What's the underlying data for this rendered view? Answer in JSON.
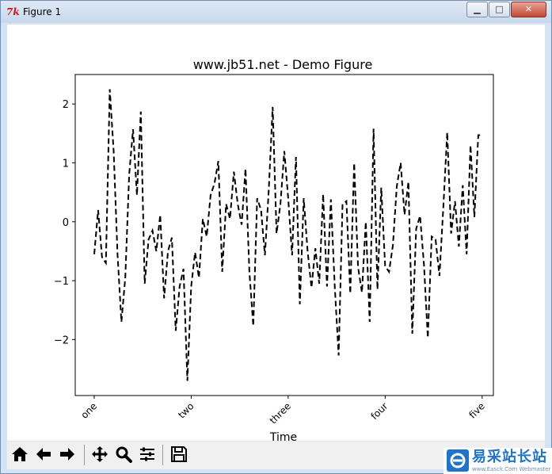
{
  "window": {
    "title": "Figure 1",
    "icon": "tk-feather-icon",
    "controls": {
      "minimize": "minimize-icon",
      "maximize": "maximize-icon",
      "close": "close-icon"
    }
  },
  "chart_data": {
    "type": "line",
    "title": "www.jb51.net - Demo Figure",
    "xlabel": "Time",
    "ylabel": "",
    "line_style": "dashed",
    "line_color": "#000000",
    "xlim": [
      -4.9,
      102.9
    ],
    "ylim": [
      -2.95,
      2.5
    ],
    "xticks": [
      0,
      25,
      50,
      75,
      100
    ],
    "xticklabels": [
      "one",
      "two",
      "three",
      "four",
      "five"
    ],
    "xtick_rotation": 45,
    "yticks": [
      -2,
      -1,
      0,
      1,
      2
    ],
    "yticklabels": [
      "−2",
      "−1",
      "0",
      "1",
      "2"
    ],
    "grid": false,
    "legend": "none",
    "series": [
      {
        "x": [
          0,
          1,
          2,
          3,
          4,
          5,
          6,
          7,
          8,
          9,
          10,
          11,
          12,
          13,
          14,
          15,
          16,
          17,
          18,
          19,
          20,
          21,
          22,
          23,
          24,
          25,
          26,
          27,
          28,
          29,
          30,
          31,
          32,
          33,
          34,
          35,
          36,
          37,
          38,
          39,
          40,
          41,
          42,
          43,
          44,
          45,
          46,
          47,
          48,
          49,
          50,
          51,
          52,
          53,
          54,
          55,
          56,
          57,
          58,
          59,
          60,
          61,
          62,
          63,
          64,
          65,
          66,
          67,
          68,
          69,
          70,
          71,
          72,
          73,
          74,
          75,
          76,
          77,
          78,
          79,
          80,
          81,
          82,
          83,
          84,
          85,
          86,
          87,
          88,
          89,
          90,
          91,
          92,
          93,
          94,
          95,
          96,
          97,
          98,
          99,
          100
        ],
        "y": [
          -0.55,
          0.2,
          -0.6,
          -0.7,
          2.25,
          1.2,
          -0.55,
          -1.7,
          -0.95,
          0.8,
          1.57,
          0.45,
          1.87,
          -1.05,
          -0.3,
          -0.15,
          -0.5,
          0.12,
          -1.3,
          -0.5,
          -0.27,
          -1.85,
          -1.1,
          -0.8,
          -2.7,
          -1.1,
          -0.52,
          -0.95,
          0.05,
          -0.25,
          0.45,
          0.65,
          1.03,
          -0.85,
          0.3,
          0.05,
          0.85,
          0.3,
          -0.05,
          0.9,
          -0.85,
          -1.77,
          0.4,
          0.2,
          -0.57,
          0.55,
          1.95,
          -0.2,
          0.3,
          1.2,
          0.4,
          -0.57,
          1.1,
          -1.4,
          0.4,
          -0.5,
          -1.12,
          -0.45,
          -1.05,
          0.47,
          -1.1,
          0.38,
          -1.1,
          -2.27,
          0.3,
          0.35,
          -1.22,
          1.0,
          -0.77,
          -1.2,
          0.0,
          -1.7,
          1.58,
          -1.15,
          0.58,
          -0.75,
          -0.85,
          -0.4,
          0.6,
          1.0,
          0.12,
          0.68,
          -1.9,
          -0.12,
          0.1,
          -0.72,
          -1.97,
          -0.25,
          -0.3,
          -0.92,
          0.25,
          1.52,
          -0.2,
          0.35,
          -0.42,
          0.62,
          -0.55,
          1.3,
          0.08,
          1.47,
          1.47
        ]
      }
    ]
  },
  "toolbar": {
    "buttons": [
      {
        "name": "home",
        "icon": "home-icon"
      },
      {
        "name": "back",
        "icon": "arrow-left-icon"
      },
      {
        "name": "forward",
        "icon": "arrow-right-icon"
      },
      {
        "name": "pan",
        "icon": "move-icon"
      },
      {
        "name": "zoom",
        "icon": "zoom-icon"
      },
      {
        "name": "configure-subplots",
        "icon": "sliders-icon"
      },
      {
        "name": "save",
        "icon": "save-icon"
      }
    ]
  },
  "watermark": {
    "text": "易采站长站",
    "subtext": "www.Easck.Com Webmaster",
    "logo": "easck-logo-icon",
    "color": "#1f73c9"
  }
}
